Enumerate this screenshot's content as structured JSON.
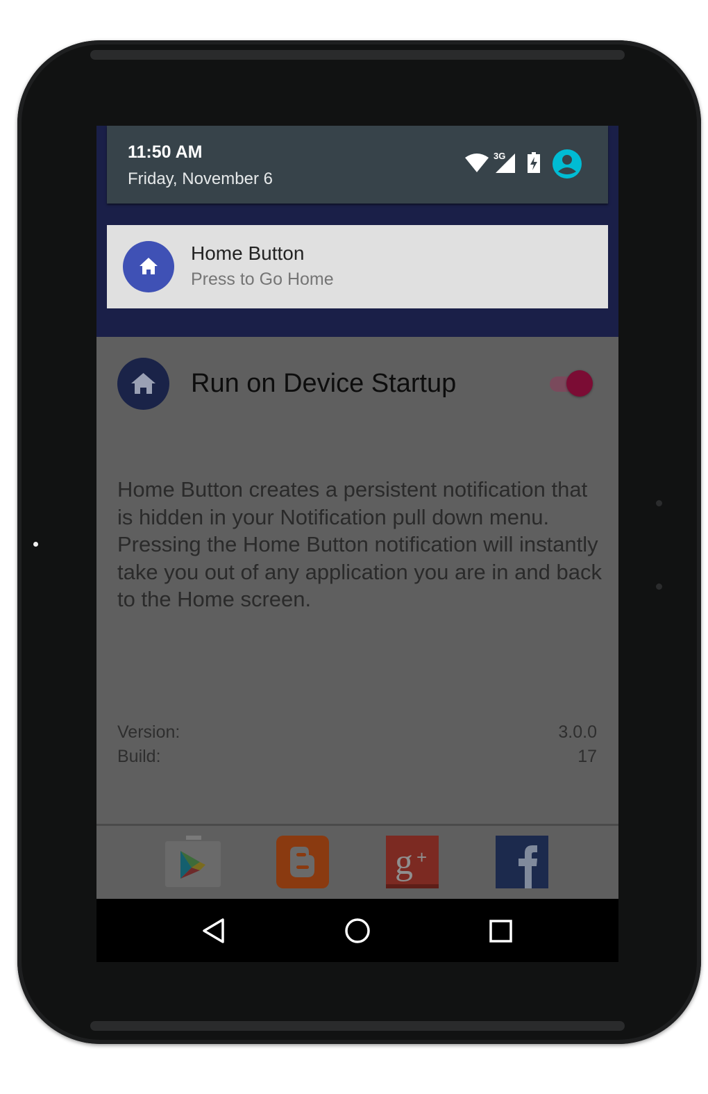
{
  "status_bar": {
    "time": "11:50 AM",
    "date": "Friday, November 6",
    "network_label": "3G",
    "icons": [
      "wifi-icon",
      "cell-signal-icon",
      "battery-charging-icon",
      "account-icon"
    ]
  },
  "notification": {
    "title": "Home Button",
    "text": "Press to Go Home",
    "icon": "home-icon"
  },
  "settings": {
    "startup_label": "Run on Device Startup",
    "startup_enabled": true
  },
  "description": "Home Button creates a persistent notification that is hidden in your Notification pull down menu. Pressing the Home Button notification will instantly take you out of any application you are in and back to the Home screen.",
  "info": {
    "version_label": "Version:",
    "version_value": "3.0.0",
    "build_label": "Build:",
    "build_value": "17"
  },
  "social_links": [
    "google-play-icon",
    "blogger-icon",
    "google-plus-icon",
    "facebook-icon"
  ],
  "nav_bar": [
    "back-icon",
    "home-icon",
    "recents-icon"
  ],
  "colors": {
    "notification_shade": "#1a1f48",
    "status_header": "#37434a",
    "notification_card": "#e0e0e0",
    "notification_icon": "#3f51b5",
    "app_background_dimmed": "#5f5f5f",
    "toggle_accent": "#7b0c34",
    "account_icon": "#00bcd4"
  }
}
